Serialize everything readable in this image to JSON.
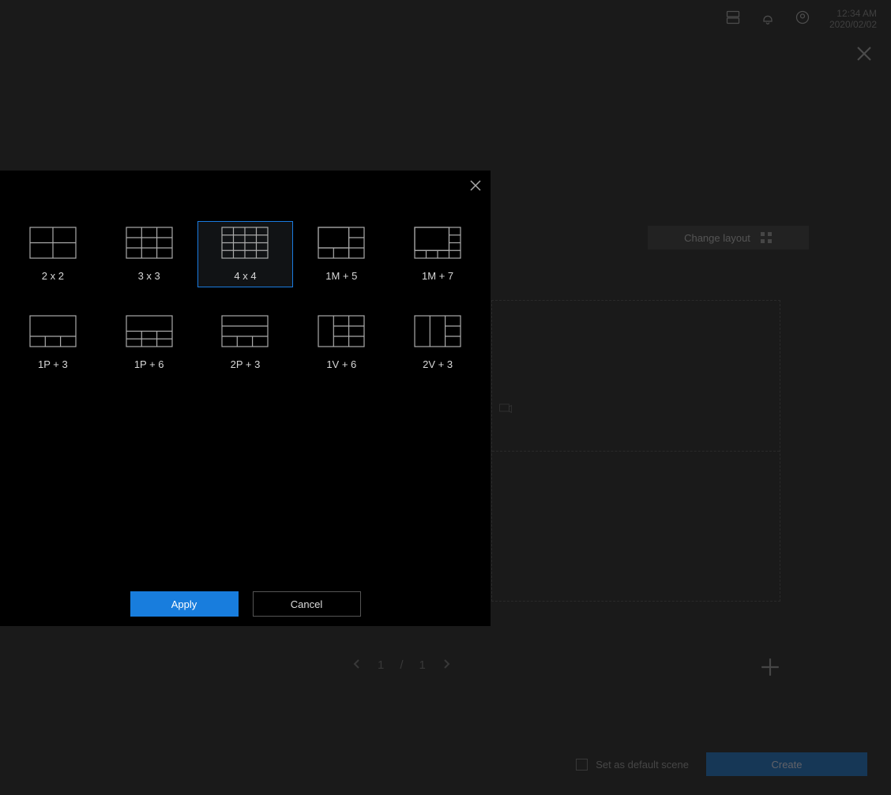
{
  "header": {
    "time": "12:34 AM",
    "date": "2020/02/02"
  },
  "background": {
    "change_layout": "Change layout",
    "pager_current": "1",
    "pager_sep": "/",
    "pager_total": "1",
    "set_default": "Set as default scene",
    "create": "Create"
  },
  "modal": {
    "apply": "Apply",
    "cancel": "Cancel",
    "selected_index": 2,
    "options": [
      {
        "label": "2 x 2",
        "thumb": "2x2"
      },
      {
        "label": "3 x 3",
        "thumb": "3x3"
      },
      {
        "label": "4 x 4",
        "thumb": "4x4"
      },
      {
        "label": "1M + 5",
        "thumb": "1M5"
      },
      {
        "label": "1M + 7",
        "thumb": "1M7"
      },
      {
        "label": "1P + 3",
        "thumb": "1P3"
      },
      {
        "label": "1P + 6",
        "thumb": "1P6"
      },
      {
        "label": "2P + 3",
        "thumb": "2P3"
      },
      {
        "label": "1V + 6",
        "thumb": "1V6"
      },
      {
        "label": "2V + 3",
        "thumb": "2V3"
      }
    ]
  }
}
